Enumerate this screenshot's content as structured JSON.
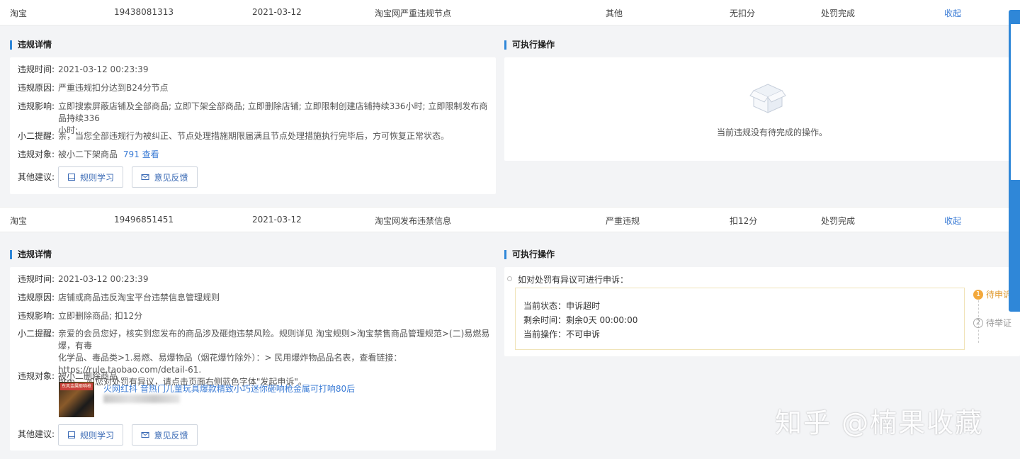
{
  "records": [
    {
      "platform": "淘宝",
      "id": "19438081313",
      "date": "2021-03-12",
      "rule": "淘宝网严重违规节点",
      "type": "其他",
      "points": "无扣分",
      "status": "处罚完成",
      "collapse_label": "收起",
      "detail_title": "违规详情",
      "actions_title": "可执行操作",
      "fields": {
        "time_label": "违规时间:",
        "time": "2021-03-12 00:23:39",
        "reason_label": "违规原因:",
        "reason": "严重违规扣分达到B24分节点",
        "impact_label": "违规影响:",
        "impact_line1": "立即搜索屏蔽店铺及全部商品; 立即下架全部商品; 立即删除店铺; 立即限制创建店铺持续336小时; 立即限制发布商品持续336",
        "impact_line2": "小时;",
        "tip_label": "小二提醒:",
        "tip": "亲，当您全部违规行为被纠正、节点处理措施期限届满且节点处理措施执行完毕后，方可恢复正常状态。",
        "target_label": "违规对象:",
        "target": "被小二下架商品",
        "target_link": "791 查看",
        "suggest_label": "其他建议:"
      },
      "buttons": {
        "learn": "规则学习",
        "feedback": "意见反馈"
      },
      "empty_text": "当前违规没有待完成的操作。"
    },
    {
      "platform": "淘宝",
      "id": "19496851451",
      "date": "2021-03-12",
      "rule": "淘宝网发布违禁信息",
      "type": "严重违规",
      "points": "扣12分",
      "status": "处罚完成",
      "collapse_label": "收起",
      "detail_title": "违规详情",
      "actions_title": "可执行操作",
      "fields": {
        "time_label": "违规时间:",
        "time": "2021-03-12 00:23:39",
        "reason_label": "违规原因:",
        "reason": "店铺或商品违反淘宝平台违禁信息管理规则",
        "impact_label": "违规影响:",
        "impact": "立即删除商品; 扣12分",
        "tip_label": "小二提醒:",
        "tip_line1": "亲爱的会员您好，核实到您发布的商品涉及砸炮违禁风险。规则详见 淘宝规则>淘宝禁售商品管理规范>(二)易燃易爆，有毒",
        "tip_line2": "化学品、毒品类>1.易燃、易爆物品（烟花爆竹除外）：> 民用爆炸物品品名表，查看链接：https://rule.taobao.com/detail-61.",
        "tip_line3": "htm。 如您对处罚有异议，请点击页面右侧蓝色字体\"发起申诉\"。",
        "target_label": "违规对象:",
        "target": "被小二删除商品",
        "product_title": "火网红抖 音热门儿童玩具爆款精致小巧迷你砸响枪金属可打响80后",
        "product_thumb_tag": "东风金属砸响枪",
        "suggest_label": "其他建议:"
      },
      "buttons": {
        "learn": "规则学习",
        "feedback": "意见反馈"
      },
      "appeal": {
        "prompt": "如对处罚有异议可进行申诉：",
        "status_line": "当前状态：申诉超时",
        "remaining_line": "剩余时间：剩余0天 00:00:00",
        "operation_line": "当前操作：不可申诉",
        "steps": [
          {
            "num": "1",
            "label": "待申诉"
          },
          {
            "num": "2",
            "label": "待举证"
          }
        ]
      }
    }
  ],
  "watermark": "知乎 @楠果收藏",
  "colors": {
    "accent": "#2f87d8",
    "link": "#3a7bd5",
    "warning": "#f3a83b"
  },
  "icons": [
    "book-icon",
    "mail-icon",
    "empty-box-icon"
  ]
}
